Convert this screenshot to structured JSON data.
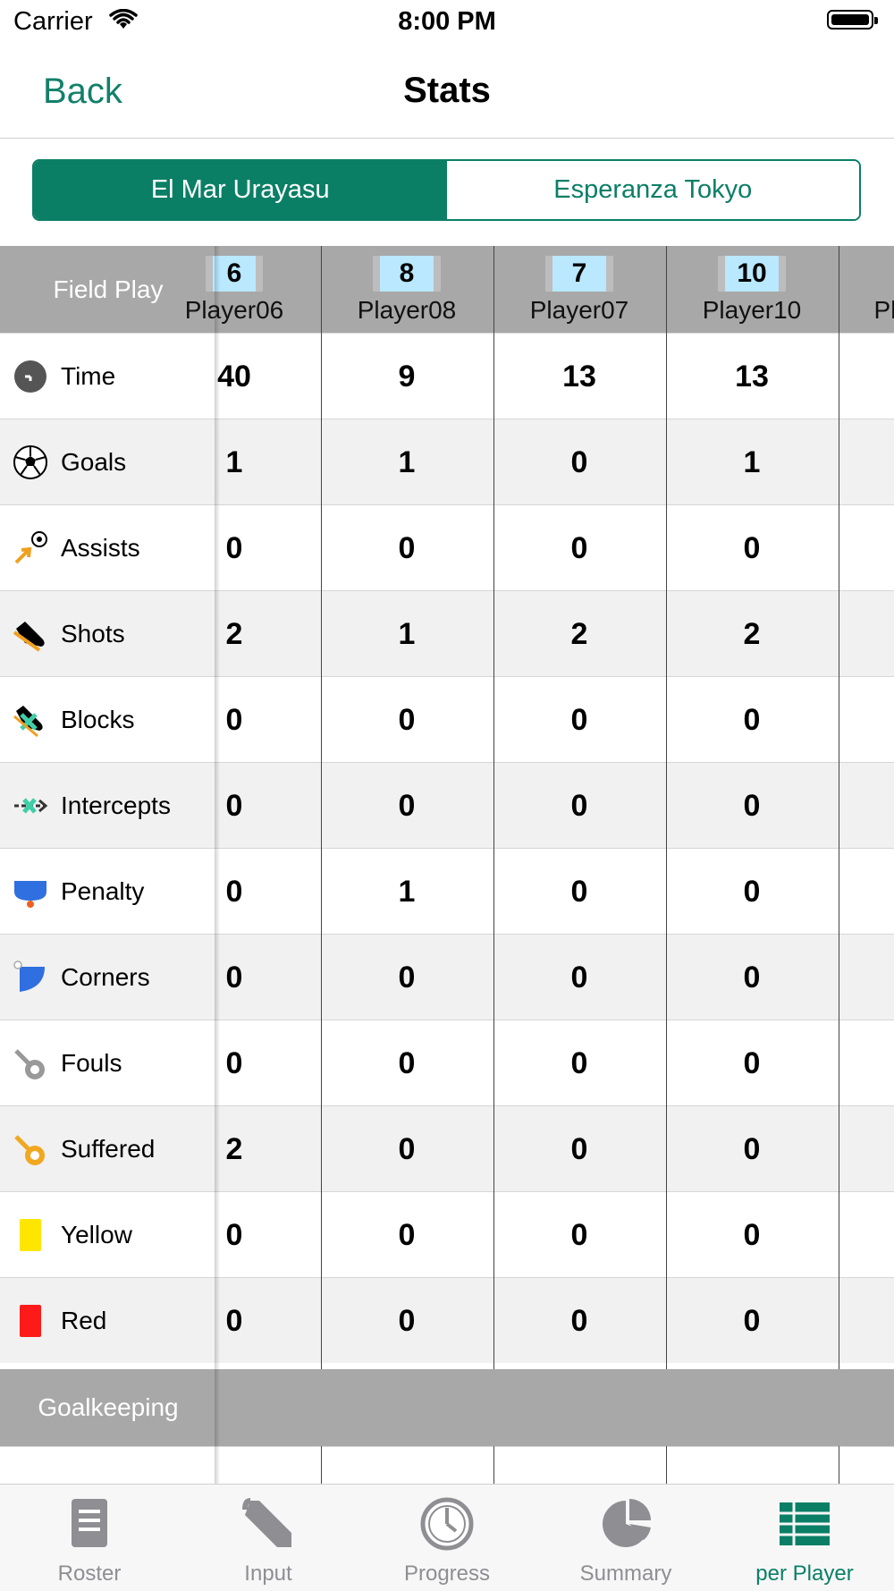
{
  "status_bar": {
    "carrier": "Carrier",
    "time": "8:00 PM"
  },
  "nav": {
    "back_label": "Back",
    "title": "Stats"
  },
  "teams": {
    "selected": "El Mar Urayasu",
    "other": "Esperanza Tokyo"
  },
  "table": {
    "section_title": "Field Play",
    "players": [
      {
        "number": "6",
        "name": "Player06"
      },
      {
        "number": "8",
        "name": "Player08"
      },
      {
        "number": "7",
        "name": "Player07"
      },
      {
        "number": "10",
        "name": "Player10"
      },
      {
        "number": "",
        "name": "Pl"
      }
    ],
    "rows": [
      {
        "label": "Time",
        "icon": "clock-icon",
        "values": [
          "40",
          "9",
          "13",
          "13",
          ""
        ]
      },
      {
        "label": "Goals",
        "icon": "soccer-ball-icon",
        "values": [
          "1",
          "1",
          "0",
          "1",
          ""
        ]
      },
      {
        "label": "Assists",
        "icon": "assist-arrow-icon",
        "values": [
          "0",
          "0",
          "0",
          "0",
          ""
        ]
      },
      {
        "label": "Shots",
        "icon": "boot-icon",
        "values": [
          "2",
          "1",
          "2",
          "2",
          ""
        ]
      },
      {
        "label": "Blocks",
        "icon": "block-boot-icon",
        "values": [
          "0",
          "0",
          "0",
          "0",
          ""
        ]
      },
      {
        "label": "Intercepts",
        "icon": "intercept-icon",
        "values": [
          "0",
          "0",
          "0",
          "0",
          ""
        ]
      },
      {
        "label": "Penalty",
        "icon": "penalty-area-icon",
        "values": [
          "0",
          "1",
          "0",
          "0",
          ""
        ]
      },
      {
        "label": "Corners",
        "icon": "corner-icon",
        "values": [
          "0",
          "0",
          "0",
          "0",
          ""
        ]
      },
      {
        "label": "Fouls",
        "icon": "whistle-gray-icon",
        "values": [
          "0",
          "0",
          "0",
          "0",
          ""
        ]
      },
      {
        "label": "Suffered",
        "icon": "whistle-orange-icon",
        "values": [
          "2",
          "0",
          "0",
          "0",
          ""
        ]
      },
      {
        "label": "Yellow",
        "icon": "yellow-card-icon",
        "values": [
          "0",
          "0",
          "0",
          "0",
          ""
        ]
      },
      {
        "label": "Red",
        "icon": "red-card-icon",
        "values": [
          "0",
          "0",
          "0",
          "0",
          ""
        ]
      }
    ],
    "goalkeeping_title": "Goalkeeping"
  },
  "tabs": [
    {
      "label": "Roster",
      "icon": "roster-icon"
    },
    {
      "label": "Input",
      "icon": "pen-icon"
    },
    {
      "label": "Progress",
      "icon": "clock-icon"
    },
    {
      "label": "Summary",
      "icon": "pie-chart-icon"
    },
    {
      "label": "per Player",
      "icon": "table-icon",
      "active": true
    }
  ],
  "colors": {
    "accent": "#0b7f66",
    "header_gray": "#a8a8a8",
    "badge": "#b9e8ff"
  }
}
